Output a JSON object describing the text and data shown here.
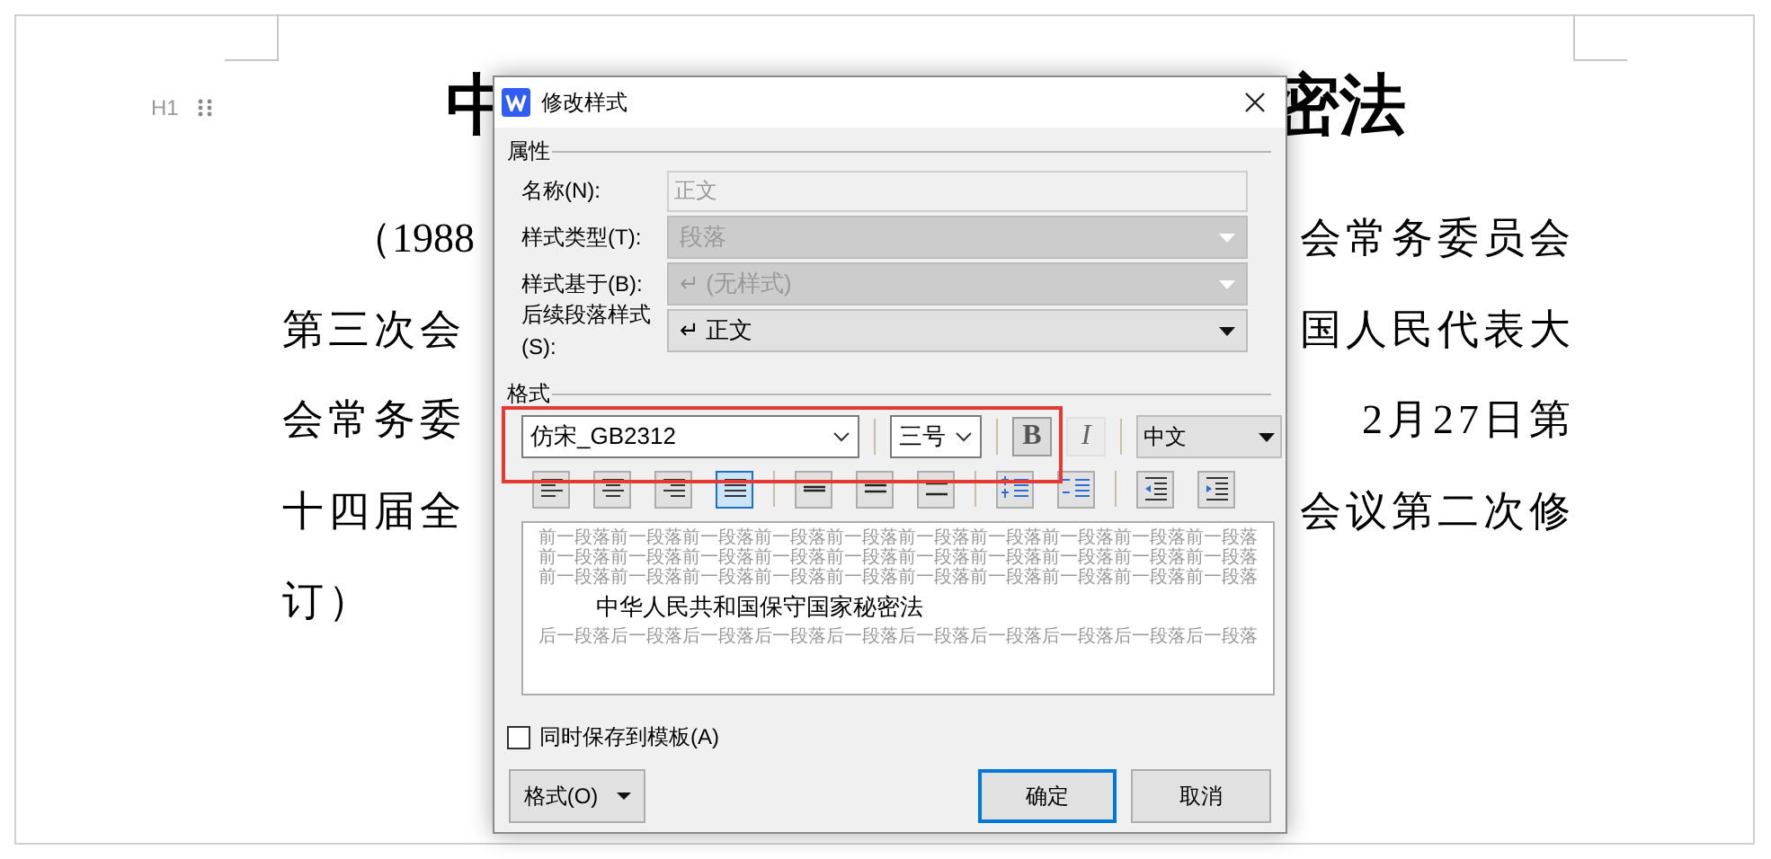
{
  "document": {
    "title_left": "中",
    "title_right": "密法",
    "heading_marker": "H1",
    "lines": [
      {
        "left": "（1988",
        "right": "会常务委员会"
      },
      {
        "left": "第三次会",
        "right": "国人民代表大"
      },
      {
        "left": "会常务委",
        "right": "2月27日第"
      },
      {
        "left": "十四届全",
        "right": "会议第二次修"
      },
      {
        "left": "订）"
      }
    ]
  },
  "dialog": {
    "title": "修改样式",
    "properties_label": "属性",
    "properties": [
      {
        "label": "名称(N):",
        "kind": "text",
        "value": "正文",
        "disabled": true
      },
      {
        "label": "样式类型(T):",
        "kind": "select",
        "value": "段落",
        "disabled": true
      },
      {
        "label": "样式基于(B):",
        "kind": "select",
        "value": "↵ (无样式)",
        "disabled": true
      },
      {
        "label": "后续段落样式(S):",
        "kind": "select",
        "value": "↵ 正文",
        "disabled": false
      }
    ],
    "format_label": "格式",
    "font": "仿宋_GB2312",
    "size": "三号",
    "bold": {
      "label": "B",
      "selected": true
    },
    "italic": {
      "label": "I",
      "selected": false
    },
    "language": "中文",
    "tools": [
      {
        "kind": "align-left",
        "selected": false
      },
      {
        "kind": "align-center",
        "selected": false
      },
      {
        "kind": "align-right",
        "selected": false
      },
      {
        "kind": "justify",
        "selected": true
      },
      {
        "kind": "separator"
      },
      {
        "kind": "spacing-single",
        "selected": false
      },
      {
        "kind": "spacing-mid",
        "selected": false
      },
      {
        "kind": "spacing-double",
        "selected": false
      },
      {
        "kind": "separator"
      },
      {
        "kind": "space-before",
        "selected": false
      },
      {
        "kind": "space-after",
        "selected": false
      },
      {
        "kind": "separator"
      },
      {
        "kind": "indent-decrease",
        "selected": false
      },
      {
        "kind": "indent-increase",
        "selected": false
      }
    ],
    "preview": {
      "before": [
        "前一段落前一段落前一段落前一段落前一段落前一段落前一段落前一段落前一段落前一段落",
        "前一段落前一段落前一段落前一段落前一段落前一段落前一段落前一段落前一段落前一段落",
        "前一段落前一段落前一段落前一段落前一段落前一段落前一段落前一段落前一段落前一段落"
      ],
      "sample": "中华人民共和国保守国家秘密法",
      "after": [
        "后一段落后一段落后一段落后一段落后一段落后一段落后一段落后一段落后一段落后一段落"
      ]
    },
    "save_to_template": {
      "label": "同时保存到模板(A)",
      "checked": false
    },
    "buttons": [
      {
        "label": "格式(O)",
        "kind": "menu"
      },
      {
        "label": "确定",
        "kind": "default"
      },
      {
        "label": "取消",
        "kind": "normal"
      }
    ]
  }
}
